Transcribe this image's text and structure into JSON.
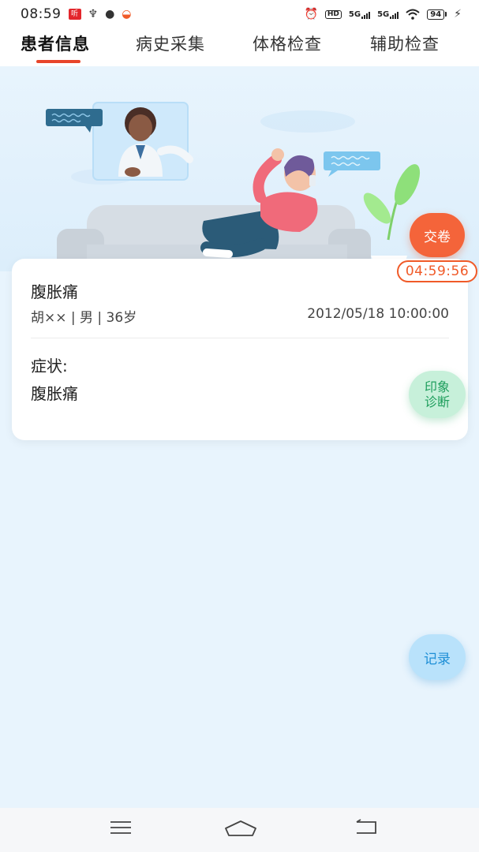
{
  "status_bar": {
    "time": "08:59",
    "battery": "94",
    "signal_1": "5G",
    "signal_2": "5G",
    "hd_badge": "HD"
  },
  "tabs": [
    {
      "label": "患者信息",
      "active": true
    },
    {
      "label": "病史采集",
      "active": false
    },
    {
      "label": "体格检查",
      "active": false
    },
    {
      "label": "辅助检查",
      "active": false
    }
  ],
  "floating": {
    "submit_label": "交卷",
    "timer": "04:59:56",
    "diagnosis_line1": "印象",
    "diagnosis_line2": "诊断",
    "record_label": "记录"
  },
  "patient": {
    "chief_complaint": "腹胀痛",
    "meta": "胡×× | 男 | 36岁",
    "visit_time": "2012/05/18 10:00:00",
    "symptom_label": "症状:",
    "symptom_value": "腹胀痛"
  },
  "colors": {
    "accent": "#f05a28",
    "tab_underline": "#e8452a",
    "diagnosis_text": "#1f9e5d",
    "record_text": "#1e8fd6",
    "background": "#e8f4fd"
  }
}
